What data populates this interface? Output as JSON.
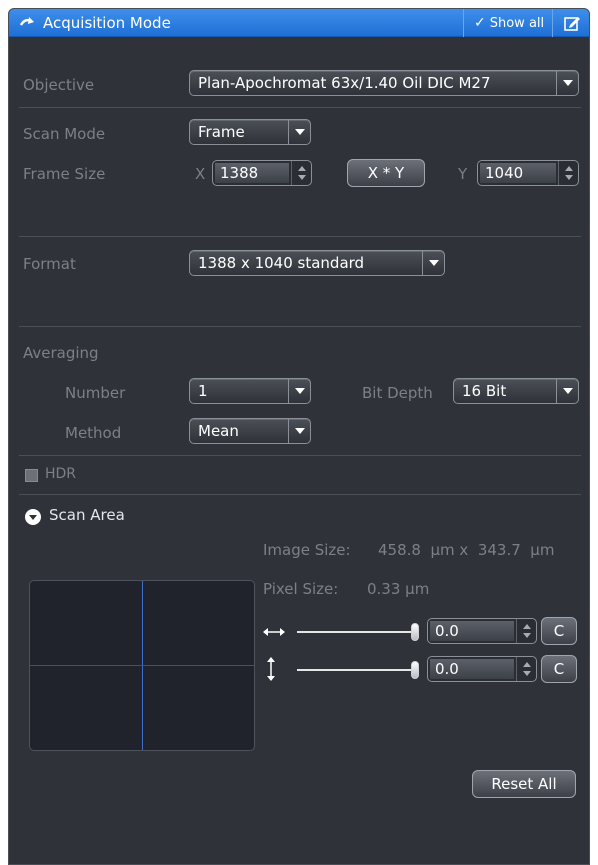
{
  "titlebar": {
    "title": "Acquisition Mode",
    "show_all": "Show all",
    "icons": {
      "collapse": "curved-arrow-icon",
      "check": "checkmark-icon",
      "edit": "edit-icon"
    }
  },
  "objective": {
    "label": "Objective",
    "value": "Plan-Apochromat 63x/1.40 Oil DIC M27"
  },
  "scan_mode": {
    "label": "Scan Mode",
    "value": "Frame"
  },
  "frame_size": {
    "label": "Frame Size",
    "x_label": "X",
    "x_value": "1388",
    "swap_button": "X * Y",
    "y_label": "Y",
    "y_value": "1040"
  },
  "format": {
    "label": "Format",
    "value": "1388 x 1040 standard"
  },
  "averaging": {
    "label": "Averaging",
    "number_label": "Number",
    "number_value": "1",
    "bit_depth_label": "Bit Depth",
    "bit_depth_value": "16 Bit",
    "method_label": "Method",
    "method_value": "Mean"
  },
  "hdr": {
    "label": "HDR",
    "checked": false
  },
  "scan_area": {
    "title": "Scan Area",
    "image_size_label": "Image Size:",
    "image_size_value": "458.8  µm x  343.7  µm",
    "pixel_size_label": "Pixel Size:",
    "pixel_size_value": "0.33 µm",
    "offset_x_value": "0.0",
    "offset_y_value": "0.0",
    "center_button": "C",
    "reset_button": "Reset All"
  },
  "colors": {
    "title_bar": "#2a7de1",
    "panel_bg": "#2f3238",
    "crosshair_vertical": "#3d6fcf",
    "crosshair_horizontal": "#c41e1e"
  }
}
